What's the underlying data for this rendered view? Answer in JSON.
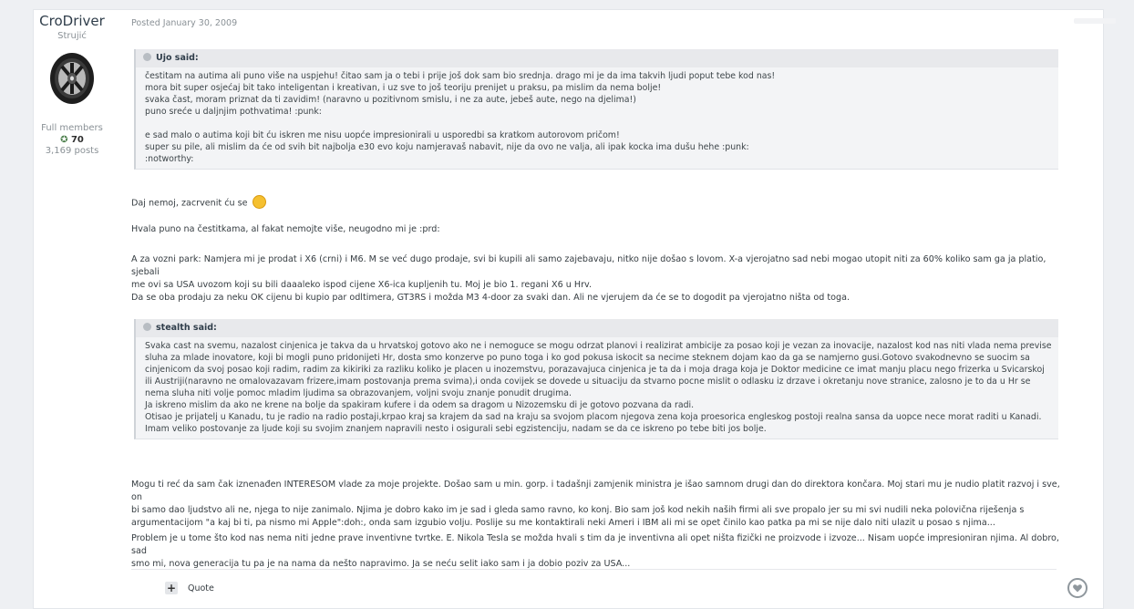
{
  "author": {
    "name": "CroDriver",
    "title": "Strujić",
    "group": "Full members",
    "reputation": "70",
    "posts": "3,169 posts"
  },
  "post": {
    "date": "Posted January 30, 2009",
    "quote1": {
      "header": "Ujo said:",
      "lines": [
        "čestitam na autima ali puno više na uspjehu! čitao sam ja o tebi i prije još dok sam bio srednja. drago mi je da ima takvih ljudi poput tebe kod nas!",
        "mora bit super osjećaj bit tako inteligentan i kreativan, i uz sve to još teoriju prenijet u praksu, pa mislim da nema bolje!",
        "svaka čast, moram priznat da ti zavidim! (naravno u pozitivnom smislu, i ne za aute, jebeš aute, nego na djelima!)",
        "puno sreće u daljnjim pothvatima! :punk:",
        "",
        "e sad malo o autima koji bit ću iskren me nisu uopće impresionirali u usporedbi sa kratkom autorovom pričom!",
        "super su pile, ali mislim da će od svih bit najbolja e30 evo koju namjeravaš nabavit, nije da ovo ne valja, ali ipak kocka ima dušu hehe :punk:",
        ":notworthy:"
      ]
    },
    "p1": "Daj nemoj, zacrvenit ću se",
    "p2": "Hvala puno na čestitkama, al fakat nemojte više, neugodno mi je :prd:",
    "p3a": "A za vozni park: Namjera mi je prodat i X6 (crni) i M6. M se već dugo prodaje, svi bi kupili ali samo zajebavaju, nitko nije došao s lovom. X-a vjerojatno sad nebi mogao utopit niti za 60% koliko sam ga ja platio, sjebali",
    "p3b": "me ovi sa USA uvozom koji su bili daaaleko ispod cijene X6-ica kupljenih tu. Moj je bio 1. regani X6 u Hrv.",
    "p4": "Da se oba prodaju za neku OK cijenu bi kupio par odltimera, GT3RS i možda M3 4-door za svaki dan. Ali ne vjerujem da će se to dogodit pa vjerojatno ništa od toga.",
    "quote2": {
      "header": "stealth said:",
      "lines": [
        "Svaka cast na svemu, nazalost cinjenica je takva da u hrvatskoj gotovo ako ne i nemoguce se mogu odrzat planovi i realizirat ambicije za posao koji je vezan za inovacije, nazalost kod nas niti vlada nema previse",
        "sluha za mlade inovatore, koji bi mogli puno pridonijeti Hr, dosta smo konzerve po puno toga i ko god pokusa iskocit sa necime steknem dojam kao da ga se namjerno gusi.Gotovo svakodnevno se suocim sa",
        "cinjenicom da svoj posao koji radim, radim za kikiriki za razliku koliko je placen u inozemstvu, porazavajuca cinjenica je ta da i moja draga koja je Doktor medicine ce imat manju placu nego frizerka u Svicarskoj",
        "ili Austriji(naravno ne omalovazavam frizere,imam postovanja prema svima),i onda covijek se dovede u situaciju da stvarno pocne mislit o odlasku iz drzave i okretanju nove stranice, zalosno je to da u Hr se",
        "nema sluha niti volje pomoc mladim ljudima sa obrazovanjem, voljni svoju znanje ponudit drugima.",
        "Ja iskreno mislim da ako ne krene na bolje da spakiram kufere i da odem sa dragom u Nizozemsku di je gotovo pozvana da radi.",
        "Otisao je prijatelj u Kanadu, tu je radio na radio postaji,krpao kraj sa krajem da sad na kraju sa svojom placom njegova zena koja proesorica engleskog postoji realna sansa da uopce nece morat raditi u Kanadi.",
        "Imam veliko postovanje za ljude koji su svojim znanjem napravili nesto i osigurali sebi egzistenciju, nadam se da ce iskreno po tebe biti jos bolje."
      ]
    },
    "p5a": "Mogu ti reć da sam čak iznenađen INTERESOM vlade za moje projekte. Došao sam u min. gorp. i tadašnji zamjenik ministra je išao samnom drugi dan do direktora končara. Moj stari mu je nudio platit razvoj i sve, on",
    "p5b": "bi samo dao ljudstvo ali ne, njega to nije zanimalo. Njima je dobro kako im je sad i gleda samo ravno, ko konj. Bio sam još kod nekih naših firmi ali sve propalo jer su mi svi nudili neka polovična riješenja s",
    "p5c": "argumentacijom \"a kaj bi ti, pa nismo mi Apple\":doh:, onda sam izgubio volju. Poslije su me kontaktirali neki Ameri i IBM ali mi se opet činilo kao patka pa mi se nije dalo niti ulazit u posao s njima...",
    "p6a": "Problem je u tome što kod nas nema niti jedne prave inventivne tvrtke. E. Nikola Tesla se možda hvali s tim da je inventivna ali opet ništa fizički ne proizvode i izvoze... Nisam uopće impresioniran njima. Al dobro, sad",
    "p6b": "smo mi, nova generacija tu pa je na nama da nešto napravimo. Ja se neću selit iako sam i ja dobio poziv za USA...",
    "quote_button": "Quote",
    "plus_symbol": "+"
  },
  "colors": {
    "accent": "#4c7f4c",
    "quote_bg": "#f3f4f6"
  }
}
